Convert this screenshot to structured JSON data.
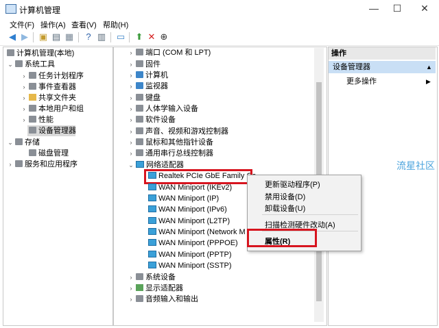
{
  "window": {
    "title": "计算机管理",
    "minimize": "—",
    "maximize": "☐",
    "close": "✕"
  },
  "menubar": [
    "文件(F)",
    "操作(A)",
    "查看(V)",
    "帮助(H)"
  ],
  "toolbar": [
    "back-icon",
    "forward-icon",
    "up-icon",
    "show-hide-tree-icon",
    "help-icon",
    "console-icon",
    "monitor-icon",
    "update-driver-icon",
    "uninstall-icon",
    "download-icon"
  ],
  "left_tree": [
    {
      "label": "计算机管理(本地)"
    },
    {
      "label": "系统工具"
    },
    {
      "label": "任务计划程序"
    },
    {
      "label": "事件查看器"
    },
    {
      "label": "共享文件夹"
    },
    {
      "label": "本地用户和组"
    },
    {
      "label": "性能"
    },
    {
      "label": "设备管理器"
    },
    {
      "label": "存储"
    },
    {
      "label": "磁盘管理"
    },
    {
      "label": "服务和应用程序"
    }
  ],
  "device_tree": [
    {
      "label": "端口 (COM 和 LPT)"
    },
    {
      "label": "固件"
    },
    {
      "label": "计算机"
    },
    {
      "label": "监视器"
    },
    {
      "label": "键盘"
    },
    {
      "label": "人体学输入设备"
    },
    {
      "label": "软件设备"
    },
    {
      "label": "声音、视频和游戏控制器"
    },
    {
      "label": "鼠标和其他指针设备"
    },
    {
      "label": "通用串行总线控制器"
    },
    {
      "label": "网络适配器"
    },
    {
      "label": "Realtek PCIe GbE Family Co"
    },
    {
      "label": "WAN Miniport (IKEv2)"
    },
    {
      "label": "WAN Miniport (IP)"
    },
    {
      "label": "WAN Miniport (IPv6)"
    },
    {
      "label": "WAN Miniport (L2TP)"
    },
    {
      "label": "WAN Miniport (Network M"
    },
    {
      "label": "WAN Miniport (PPPOE)"
    },
    {
      "label": "WAN Miniport (PPTP)"
    },
    {
      "label": "WAN Miniport (SSTP)"
    },
    {
      "label": "系统设备"
    },
    {
      "label": "显示适配器"
    },
    {
      "label": "音频输入和输出"
    }
  ],
  "actions": {
    "header": "操作",
    "device_manager": "设备管理器",
    "more": "更多操作"
  },
  "context_menu": {
    "update_driver": "更新驱动程序(P)",
    "disable": "禁用设备(D)",
    "uninstall": "卸载设备(U)",
    "scan": "扫描检测硬件改动(A)",
    "properties": "属性(R)"
  },
  "watermark": "流星社区",
  "colors": {
    "highlight": "#d7141e",
    "selection": "#c9dff5"
  }
}
